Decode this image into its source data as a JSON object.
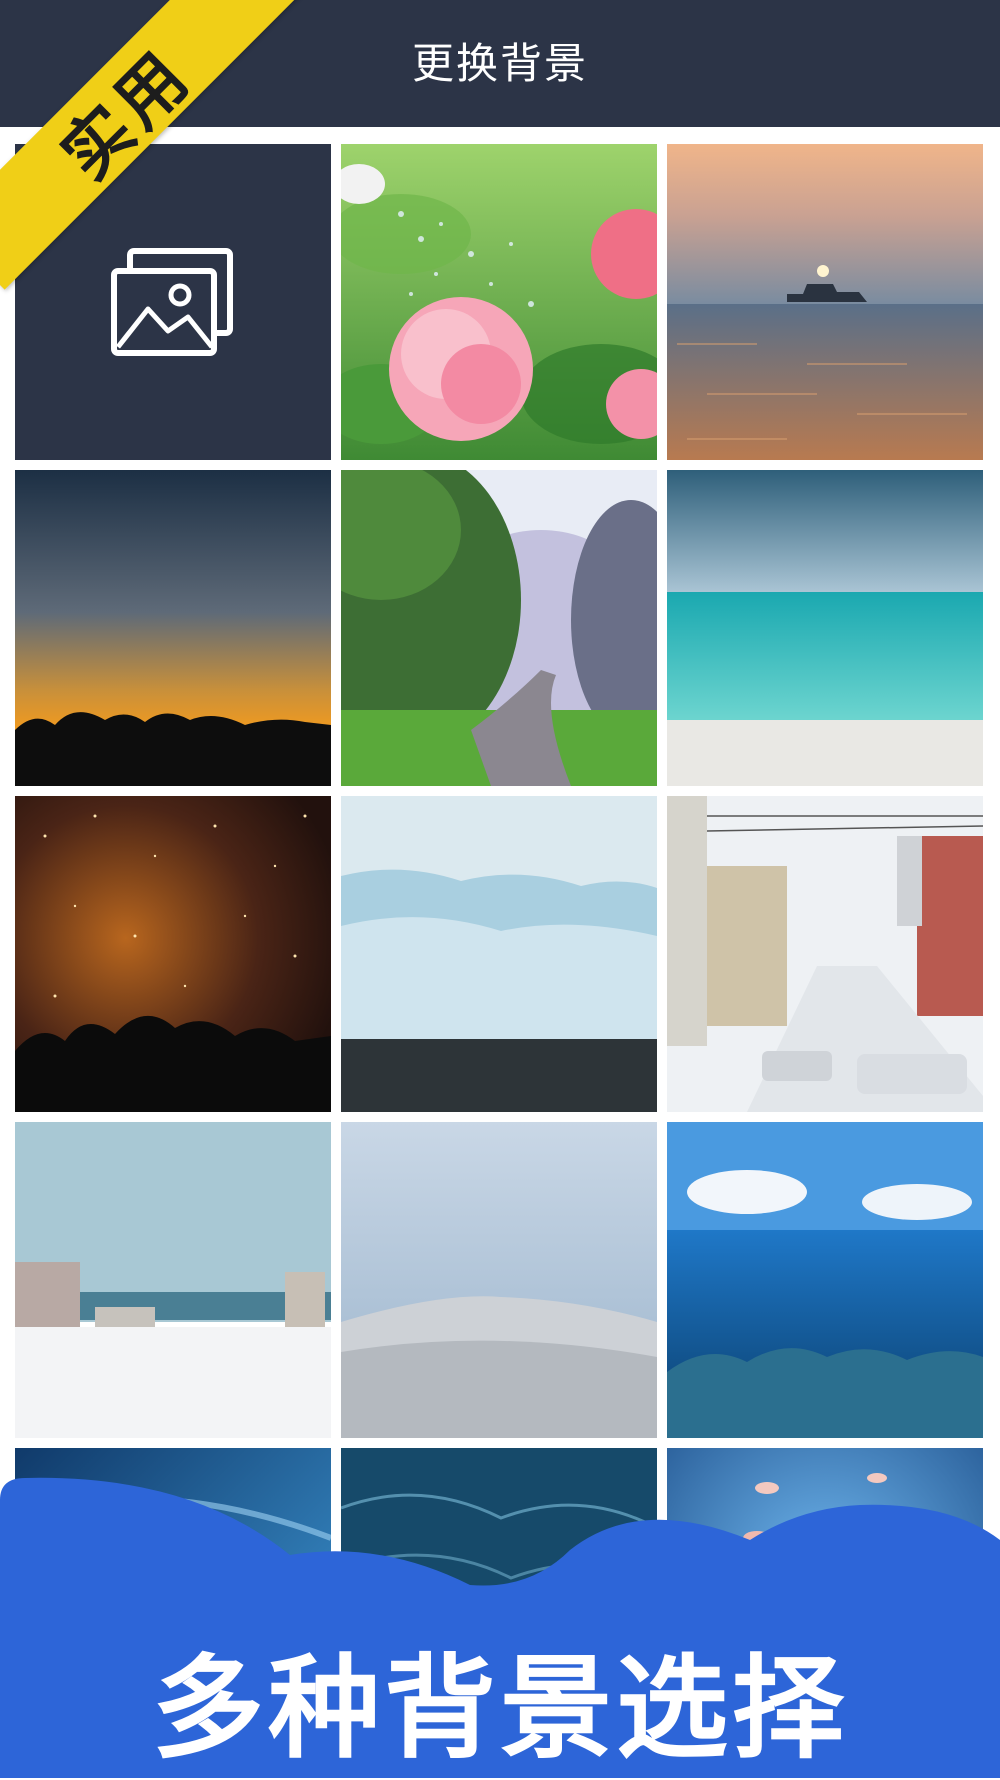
{
  "header": {
    "title": "更换背景"
  },
  "badge": {
    "label": "实用"
  },
  "picker": {
    "icon": "image-gallery-icon"
  },
  "backgrounds": [
    "flower-watering",
    "sunset-sea-boat",
    "orange-dusk-silhouette",
    "forest-path",
    "turquoise-sea",
    "starry-night",
    "glacier",
    "snowy-street",
    "snowy-town",
    "snowy-hill",
    "underwater-reef",
    "blue-light-streaks",
    "deep-ocean",
    "floating-jellyfish"
  ],
  "banner": {
    "text": "多种背景选择"
  },
  "colors": {
    "header": "#2c3447",
    "banner": "#2d65d8",
    "badge": "#f0cf17"
  }
}
